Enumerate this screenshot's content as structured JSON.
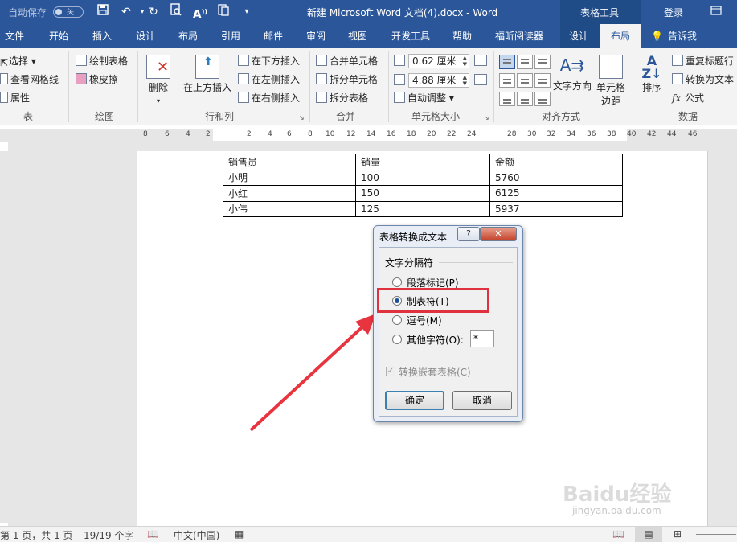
{
  "titlebar": {
    "autosave_label": "自动保存",
    "autosave_state": "关",
    "doc_title": "新建 Microsoft Word 文档(4).docx - Word",
    "context_label": "表格工具",
    "login": "登录"
  },
  "tabs": [
    "文件",
    "开始",
    "插入",
    "设计",
    "布局",
    "引用",
    "邮件",
    "审阅",
    "视图",
    "开发工具",
    "帮助",
    "福昕阅读器",
    "设计",
    "布局",
    "告诉我"
  ],
  "ribbon": {
    "table": {
      "select": "选择",
      "gridlines": "查看网格线",
      "properties": "属性",
      "group": "表"
    },
    "draw": {
      "draw_table": "绘制表格",
      "eraser": "橡皮擦",
      "group": "绘图"
    },
    "rows_cols": {
      "delete": "删除",
      "insert_above": "在上方插入",
      "insert_below": "在下方插入",
      "insert_left": "在左侧插入",
      "insert_right": "在右侧插入",
      "group": "行和列"
    },
    "merge": {
      "merge_cells": "合并单元格",
      "split_cells": "拆分单元格",
      "split_table": "拆分表格",
      "group": "合并"
    },
    "cell_size": {
      "height": "0.62 厘米",
      "width": "4.88 厘米",
      "autofit": "自动调整",
      "group": "单元格大小"
    },
    "alignment": {
      "text_direction": "文字方向",
      "cell_margins_1": "单元格",
      "cell_margins_2": "边距",
      "group": "对齐方式"
    },
    "data": {
      "sort": "排序",
      "repeat_header": "重复标题行",
      "convert_text": "转换为文本",
      "formula": "公式",
      "group": "数据"
    }
  },
  "ruler_numbers": [
    "8",
    "6",
    "4",
    "2",
    "2",
    "4",
    "6",
    "8",
    "10",
    "12",
    "14",
    "16",
    "18",
    "20",
    "22",
    "24",
    "28",
    "30",
    "32",
    "34",
    "36",
    "38",
    "40",
    "42",
    "44",
    "46"
  ],
  "table": {
    "headers": [
      "销售员",
      "销量",
      "金额"
    ],
    "rows": [
      [
        "小明",
        "100",
        "5760"
      ],
      [
        "小红",
        "150",
        "6125"
      ],
      [
        "小伟",
        "125",
        "5937"
      ]
    ]
  },
  "dialog": {
    "title": "表格转换成文本",
    "help": "?",
    "section": "文字分隔符",
    "options": [
      "段落标记(P)",
      "制表符(T)",
      "逗号(M)",
      "其他字符(O):"
    ],
    "selected_index": 1,
    "other_value": "*",
    "nested_checkbox": "转换嵌套表格(C)",
    "ok": "确定",
    "cancel": "取消",
    "highlight_color": "#e0313f",
    "arrow_color": "#e8343f"
  },
  "statusbar": {
    "page": "第 1 页，共 1 页",
    "words": "19/19 个字",
    "language": "中文(中国)"
  },
  "watermark": {
    "brand": "Baidu经验",
    "url": "jingyan.baidu.com"
  }
}
